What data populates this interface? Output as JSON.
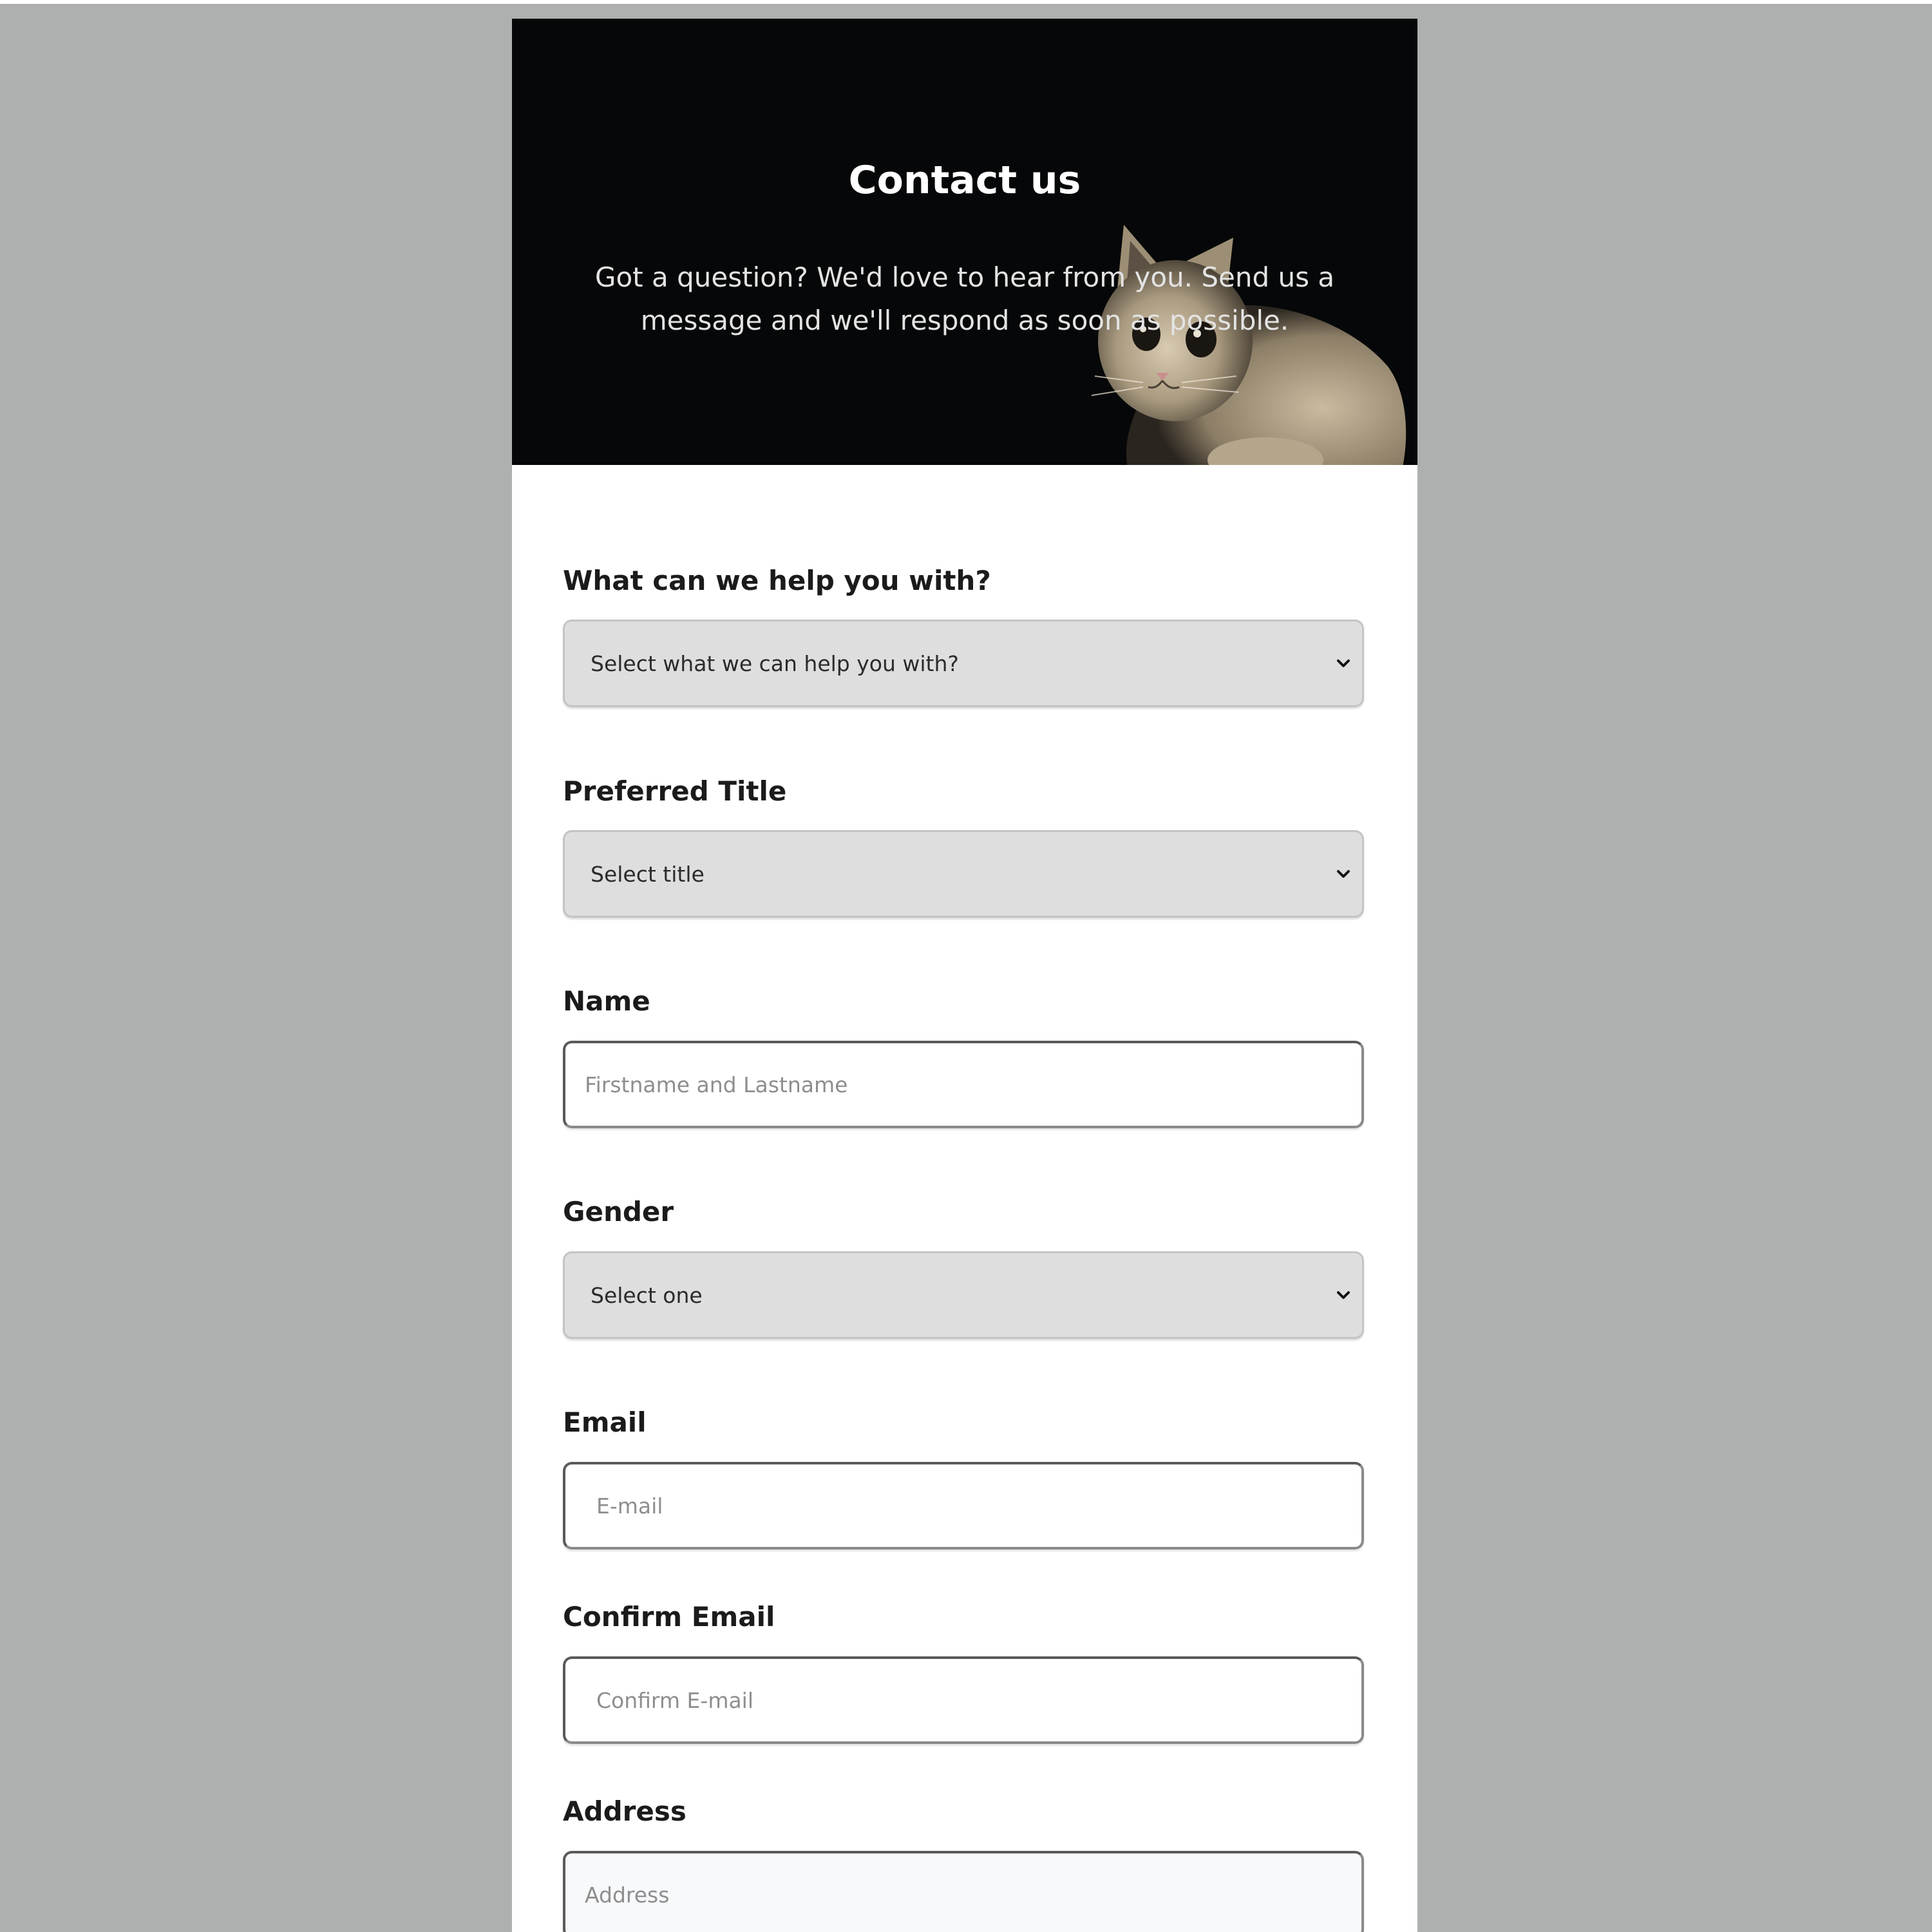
{
  "header": {
    "title": "Contact us",
    "subtitle": "Got a question? We'd love to hear from you. Send us a message and we'll respond as soon as possible."
  },
  "form": {
    "help": {
      "label": "What can we help you with?",
      "selected": "Select what we can help you with?"
    },
    "title": {
      "label": "Preferred Title",
      "selected": "Select title"
    },
    "name": {
      "label": "Name",
      "placeholder": "Firstname and Lastname",
      "value": ""
    },
    "gender": {
      "label": "Gender",
      "selected": "Select one"
    },
    "email": {
      "label": "Email",
      "placeholder": "E-mail",
      "value": ""
    },
    "confirm_email": {
      "label": "Confirm Email",
      "placeholder": "Confirm E-mail",
      "value": ""
    },
    "address": {
      "label": "Address",
      "placeholder": "Address",
      "value": ""
    }
  },
  "icons": {
    "dropdown": "chevron-down-icon",
    "hero_image": "cat-photo"
  },
  "colors": {
    "page_background": "#adb0af",
    "hero_background": "#050708",
    "select_background": "#dedede",
    "card_background": "#ffffff"
  }
}
